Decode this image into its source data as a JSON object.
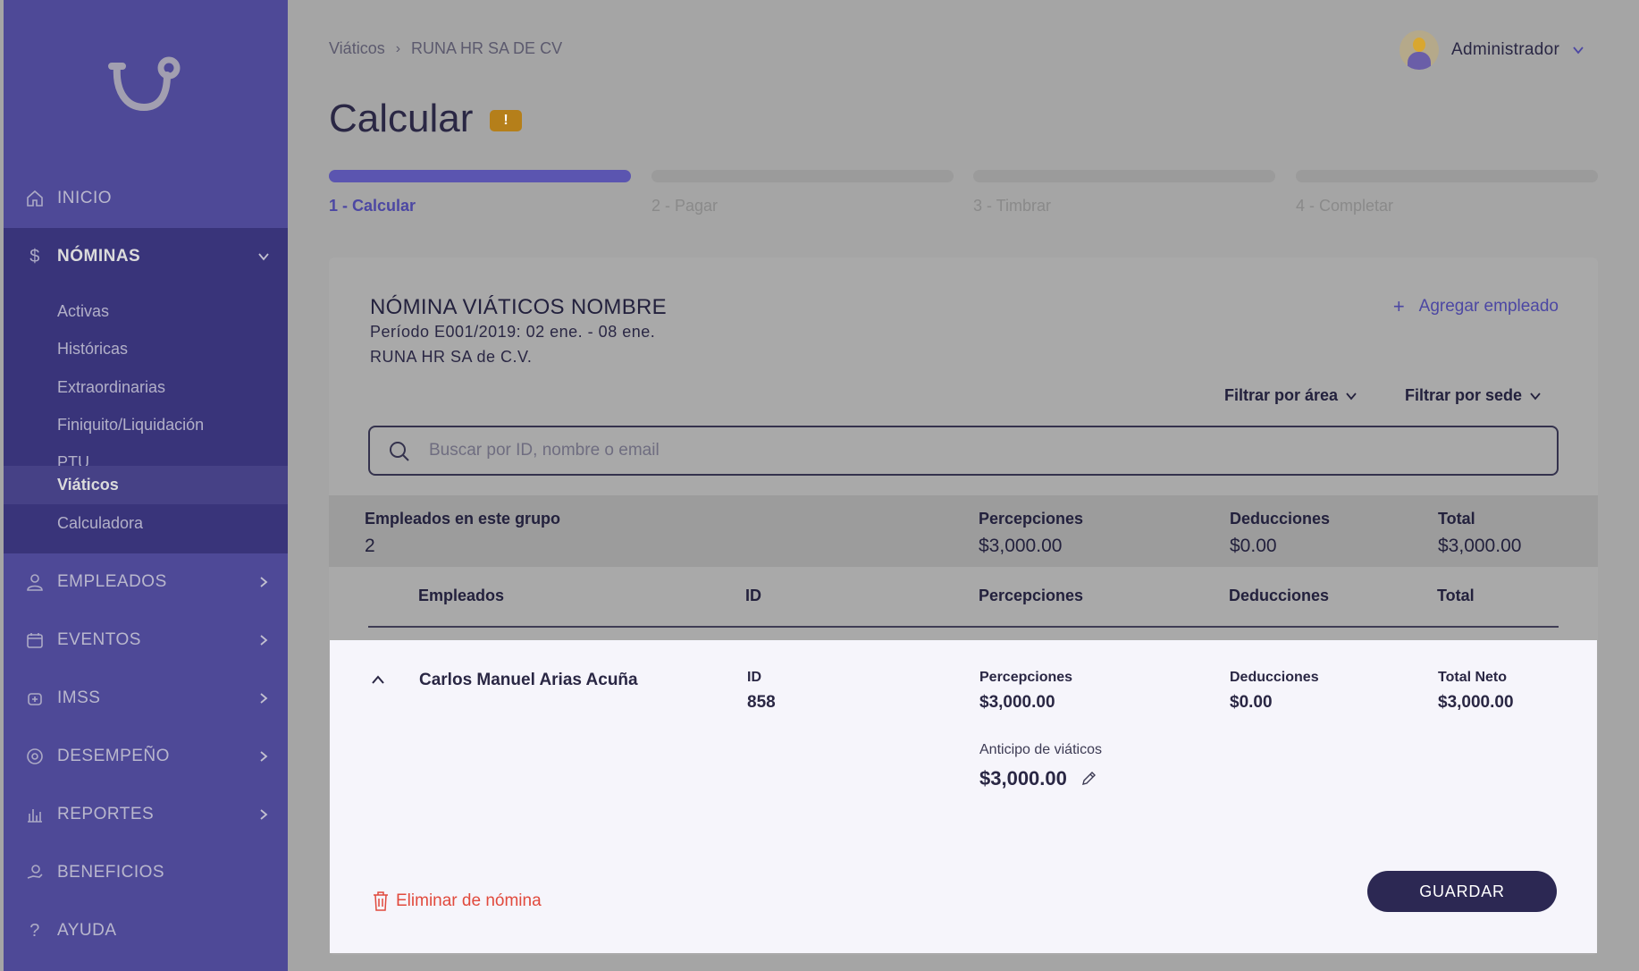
{
  "sidebar": {
    "items": [
      {
        "label": "INICIO",
        "icon": "home-icon"
      },
      {
        "label": "NÓMINAS",
        "icon": "dollar-icon"
      },
      {
        "label": "EMPLEADOS",
        "icon": "user-icon"
      },
      {
        "label": "EVENTOS",
        "icon": "calendar-icon"
      },
      {
        "label": "IMSS",
        "icon": "health-icon"
      },
      {
        "label": "DESEMPEÑO",
        "icon": "performance-icon"
      },
      {
        "label": "REPORTES",
        "icon": "chart-icon"
      },
      {
        "label": "BENEFICIOS",
        "icon": "benefits-icon"
      },
      {
        "label": "AYUDA",
        "icon": "help-icon"
      }
    ],
    "nominas_sub": [
      "Activas",
      "Históricas",
      "Extraordinarias",
      "Finiquito/Liquidación",
      "PTU",
      "Viáticos",
      "Calculadora"
    ],
    "active_sub": "Viáticos"
  },
  "header": {
    "breadcrumb": [
      "Viáticos",
      "RUNA HR SA DE CV"
    ],
    "user_name": "Administrador",
    "title": "Calcular",
    "warning_badge": "!"
  },
  "steps": [
    {
      "label": "1 - Calcular",
      "active": true
    },
    {
      "label": "2 - Pagar",
      "active": false
    },
    {
      "label": "3 - Timbrar",
      "active": false
    },
    {
      "label": "4 - Completar",
      "active": false
    }
  ],
  "card": {
    "title": "NÓMINA VIÁTICOS NOMBRE",
    "period": "Período E001/2019:  02 ene. - 08 ene.",
    "company": "RUNA HR SA de C.V.",
    "add_employee": "Agregar empleado",
    "filter_area": "Filtrar por área",
    "filter_sede": "Filtrar por sede",
    "search_placeholder": "Buscar por ID, nombre o email"
  },
  "summary": {
    "employees_label": "Empleados en este grupo",
    "employees_count": "2",
    "percepciones_label": "Percepciones",
    "percepciones": "$3,000.00",
    "deducciones_label": "Deducciones",
    "deducciones": "$0.00",
    "total_label": "Total",
    "total": "$3,000.00"
  },
  "table": {
    "headers": [
      "Empleados",
      "ID",
      "Percepciones",
      "Deducciones",
      "Total"
    ]
  },
  "row": {
    "name": "Carlos Manuel Arias Acuña",
    "id_label": "ID",
    "id": "858",
    "percepciones_label": "Percepciones",
    "percepciones": "$3,000.00",
    "deducciones_label": "Deducciones",
    "deducciones": "$0.00",
    "total_label": "Total Neto",
    "total": "$3,000.00",
    "anticipo_label": "Anticipo de viáticos",
    "anticipo": "$3,000.00",
    "delete_label": "Eliminar de nómina",
    "save_label": "GUARDAR"
  },
  "colors": {
    "sidebar": "#5b55b0",
    "accent": "#4c47a3",
    "primary_button": "#2c2853",
    "danger": "#e14a3d",
    "warning": "#b57f1a"
  }
}
